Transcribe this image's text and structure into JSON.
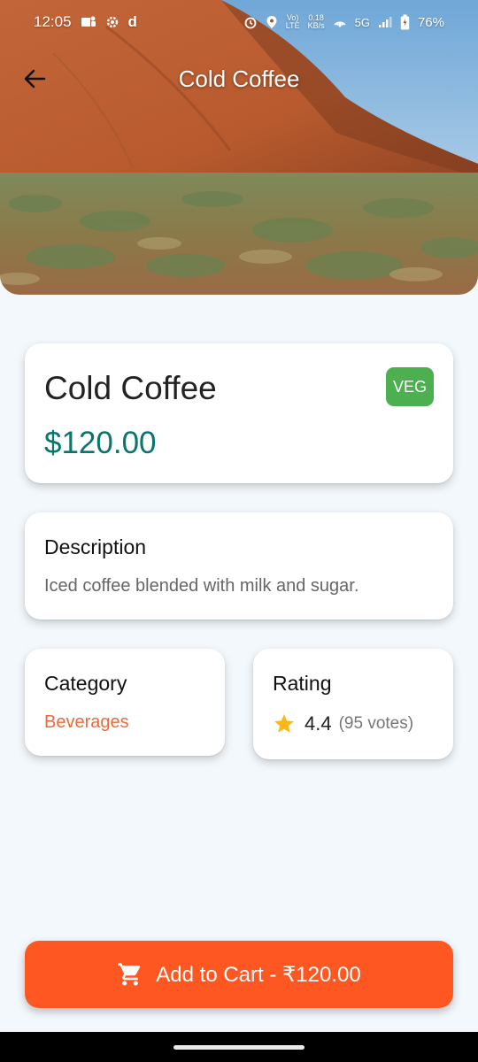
{
  "status_bar": {
    "time": "12:05",
    "network_speed_top": "0.18",
    "network_speed_bottom": "KB/s",
    "volte_top": "Vo)",
    "volte_bottom": "LTE",
    "network_type": "5G",
    "battery": "76%",
    "icons": [
      "teams-icon",
      "settings-gear-icon",
      "d-app-icon",
      "alarm-icon",
      "location-icon",
      "hotspot-icon",
      "signal-icon",
      "battery-icon"
    ]
  },
  "app_bar": {
    "title": "Cold Coffee",
    "back_icon": "arrow-left-icon"
  },
  "product": {
    "name": "Cold Coffee",
    "badge": "VEG",
    "price": "$120.00"
  },
  "description": {
    "heading": "Description",
    "text": "Iced coffee blended with milk and sugar."
  },
  "category": {
    "heading": "Category",
    "value": "Beverages"
  },
  "rating": {
    "heading": "Rating",
    "value": "4.4",
    "votes": "(95 votes)",
    "icon": "star-icon"
  },
  "cart": {
    "label": "Add to Cart - ₹120.00",
    "icon": "shopping-cart-icon"
  },
  "colors": {
    "background": "#f3f8fc",
    "price": "#08766c",
    "veg_badge": "#4caf50",
    "category": "#ee6a3c",
    "star": "#f9b816",
    "cart_button": "#ff5722"
  }
}
